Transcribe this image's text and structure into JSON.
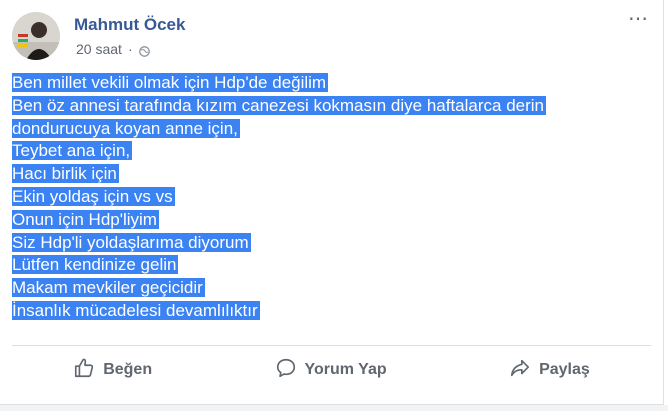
{
  "post": {
    "author": "Mahmut Öcek",
    "time": "20 saat",
    "separator": "·",
    "lines": [
      "Ben millet vekili olmak için Hdp'de değilim",
      "Ben öz annesi tarafında kızım canezesi kokmasın diye haftalarca derin",
      "dondurucuya koyan anne için,",
      "Teybet ana için,",
      "Hacı birlik için",
      "Ekin yoldaş için vs vs",
      "Onun için Hdp'liyim",
      "Siz Hdp'li yoldaşlarıma diyorum",
      "Lütfen kendinize gelin",
      "Makam mevkiler geçicidir",
      "İnsanlık mücadelesi devamlılıktır"
    ],
    "more_icon": "⋯"
  },
  "actions": {
    "like": "Beğen",
    "comment": "Yorum Yap",
    "share": "Paylaş"
  },
  "colors": {
    "author": "#385898",
    "highlight": "#3b82f3",
    "muted": "#606770"
  }
}
